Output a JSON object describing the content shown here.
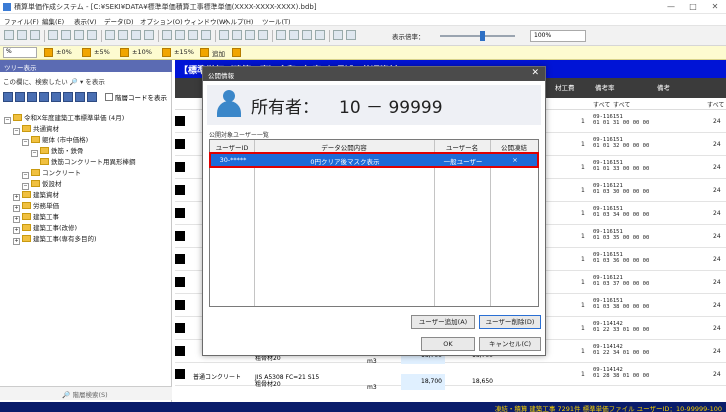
{
  "window": {
    "title": "積算単価作成システム - [C:¥SEKI¥DATA¥標準単価積算工事標準単価(XXXX-XXXX-XXXX).bdb]",
    "minimize": "—",
    "maximize": "□",
    "close": "✕"
  },
  "menu": [
    "ファイル(F)",
    "編集(E)",
    "表示(V)",
    "データ(D)",
    "オプション(O)",
    "ウィンドウ(W)",
    "ヘルプ(H)",
    "ツール(T)"
  ],
  "toolbar": {
    "zoom_label": "表示倍率：",
    "zoom_value": "100%"
  },
  "ratebar": {
    "combo": "%",
    "items": [
      "±0%",
      "±5%",
      "±10%",
      "±15%",
      "追加"
    ]
  },
  "left_panel": {
    "header": "ツリー表示",
    "search": "この欄に、検索したい 🔎 ▾ を表示",
    "checkbox_label": "階層コードを表示",
    "tree": [
      {
        "label": "令和X年度建築工事標準単価 (4月)",
        "level": 0
      },
      {
        "label": "共通資材",
        "level": 1
      },
      {
        "label": "躯体 (市中価格)",
        "level": 2
      },
      {
        "label": "鉄筋・鉄骨",
        "level": 3
      },
      {
        "label": "鉄筋コンクリート用異形棒鋼",
        "level": 4
      },
      {
        "label": "コンクリート",
        "level": 2
      },
      {
        "label": "仮設材",
        "level": 2
      },
      {
        "label": "建築資材",
        "level": 1
      },
      {
        "label": "労務単価",
        "level": 1
      },
      {
        "label": "建築工事",
        "level": 1
      },
      {
        "label": "建築工事(改修)",
        "level": 1
      },
      {
        "label": "建築工事(専有多目的)",
        "level": 1
      }
    ],
    "footer_button": "🔎 階層検索(S)"
  },
  "main": {
    "header": "【標準単価（建築工事）令和X年度（4月）】 共通資材",
    "columns": [
      "材工費",
      "備考率",
      "備考"
    ],
    "filters": [
      "すべて",
      "すべて",
      "すべて"
    ],
    "rows": [
      {
        "date": "09-116151\n01 01 31 00 00 00",
        "qty": "1",
        "code": "24"
      },
      {
        "date": "09-116151\n01 01 32 00 00 00",
        "qty": "1",
        "code": "24"
      },
      {
        "date": "09-116151\n01 01 33 00 00 00",
        "qty": "1",
        "code": "24"
      },
      {
        "date": "09-116121\n01 03 30 00 00 00",
        "qty": "1",
        "code": "24"
      },
      {
        "date": "09-116151\n01 03 34 00 00 00",
        "qty": "1",
        "code": "24"
      },
      {
        "date": "09-116151\n01 03 35 00 00 00",
        "qty": "1",
        "code": "24"
      },
      {
        "date": "09-116151\n01 03 36 00 00 00",
        "qty": "1",
        "code": "24"
      },
      {
        "date": "09-116121\n01 03 37 00 00 00",
        "qty": "1",
        "code": "24"
      },
      {
        "date": "09-116151\n01 03 38 00 00 00",
        "qty": "1",
        "code": "24"
      },
      {
        "date": "09-114142\n01 22 33 01 00 00",
        "qty": "1",
        "code": "24"
      },
      {
        "date": "09-114142\n01 22 34 01 00 00",
        "qty": "1",
        "code": "24"
      },
      {
        "date": "09-114142\n01 28 38 01 00 00",
        "qty": "1",
        "code": "24"
      }
    ],
    "bottom_rows": [
      {
        "name": "",
        "spec": "JIS A5308\n粗骨材20",
        "unit": "m3",
        "price1": "18,700",
        "price2": "18,700"
      },
      {
        "name": "普通コンクリート",
        "spec": "JIS A5308 FC=21 S15\n粗骨材20",
        "unit": "m3",
        "price1": "18,700",
        "price2": "18,650"
      }
    ]
  },
  "status": "凍結・積算 建築工事 7291件 標準単価ファイル ユーザーID：10-99999-100",
  "dialog": {
    "title": "公開情報",
    "close": "✕",
    "owner_label": "所有者：",
    "owner_value": "10 － 99999",
    "section_label": "公開対象ユーザー一覧",
    "columns": [
      "ユーザーID",
      "データ公開内容",
      "ユーザー名",
      "公開凍結"
    ],
    "rows": [
      {
        "id": "30-*****",
        "content": "0円クリア後マスク表示",
        "name": "一般ユーザー",
        "frozen": "×"
      }
    ],
    "add_user": "ユーザー追加(A)",
    "remove_user": "ユーザー削除(D)",
    "ok": "OK",
    "cancel": "キャンセル(C)"
  },
  "colors": {
    "dialog_selection": "#1d6bd8",
    "selection_outline": "#e00000",
    "main_header": "#0014d6",
    "status_bg": "#0a1d6b",
    "status_text": "#f7d000",
    "rate_button": "#f1a500"
  }
}
